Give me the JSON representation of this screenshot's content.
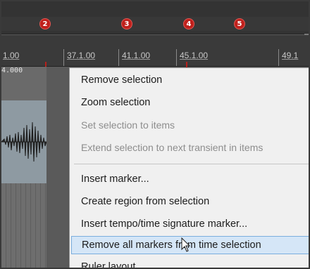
{
  "markers": [
    "2",
    "3",
    "4",
    "5"
  ],
  "ruler": {
    "labels": [
      "1.00",
      "37.1.00",
      "41.1.00",
      "45.1.00",
      "49.1"
    ],
    "item_label": "4.000"
  },
  "context_menu": {
    "items": [
      {
        "label": "Remove selection",
        "enabled": true
      },
      {
        "label": "Zoom selection",
        "enabled": true
      },
      {
        "label": "Set selection to items",
        "enabled": false
      },
      {
        "label": "Extend selection to next transient in items",
        "enabled": false
      },
      {
        "label": "Insert marker...",
        "enabled": true
      },
      {
        "label": "Create region from selection",
        "enabled": true
      },
      {
        "label": "Insert tempo/time signature marker...",
        "enabled": true
      },
      {
        "label": "Remove all markers from time selection",
        "enabled": true,
        "hovered": true
      },
      {
        "label": "Ruler layout",
        "enabled": true
      }
    ]
  },
  "colors": {
    "marker": "#c0201c",
    "menu_background": "#f0f0f0",
    "menu_hover": "#d5e6f7",
    "disabled_text": "#8d8d8d"
  }
}
